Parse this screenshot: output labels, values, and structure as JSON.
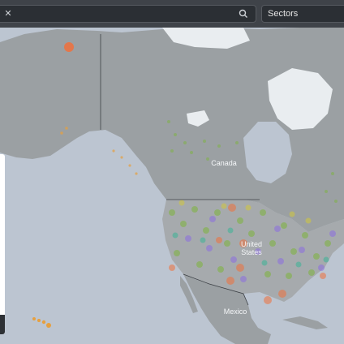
{
  "search": {
    "value": "",
    "placeholder": ""
  },
  "icons": {
    "clear": "close-icon",
    "search": "search-icon"
  },
  "sectors_label": "Sectors",
  "map": {
    "labels": {
      "canada": "Canada",
      "united_states": "United States",
      "mexico": "Mexico"
    },
    "colors": {
      "ocean": "#bcc5d1",
      "land": "#9ba0a3",
      "us_land": "#a6aaad",
      "border": "#3c4045",
      "ice": "#e9edf0",
      "marker_green": "#7db43c",
      "marker_orange": "#f0703c",
      "marker_purple": "#8c6ee0",
      "marker_teal": "#3cb496",
      "marker_yellow": "#d2c83c"
    }
  }
}
